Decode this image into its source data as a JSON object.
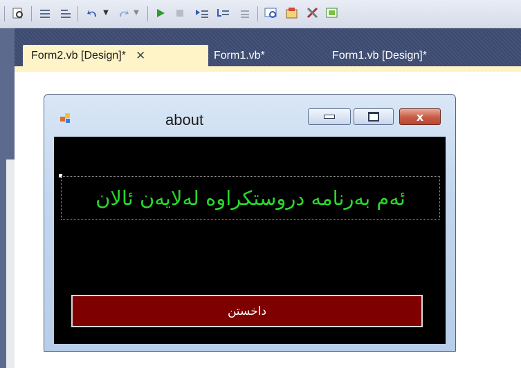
{
  "toolbar": {
    "buttons": [
      "find-icon",
      "comment-icon",
      "uncomment-icon",
      "undo-icon",
      "redo-icon",
      "start-icon",
      "stop-icon",
      "step-into-icon",
      "step-over-icon",
      "step-out-icon",
      "solution-explorer-icon",
      "properties-icon",
      "toolbox-icon",
      "object-browser-icon"
    ]
  },
  "tabs": [
    {
      "label": "Form2.vb [Design]*",
      "active": true,
      "close": "✕"
    },
    {
      "label": "Form1.vb*",
      "active": false
    },
    {
      "label": "Form1.vb [Design]*",
      "active": false
    }
  ],
  "form": {
    "title": "about",
    "close_glyph": "x",
    "label_text": "ئەم بەرنامە دروستکراوە لەلایەن ئالان",
    "button_text": "داخستن",
    "colors": {
      "client_bg": "#000000",
      "label_fg": "#27d92a",
      "button_bg": "#7e0000",
      "button_fg": "#ffffff"
    }
  }
}
